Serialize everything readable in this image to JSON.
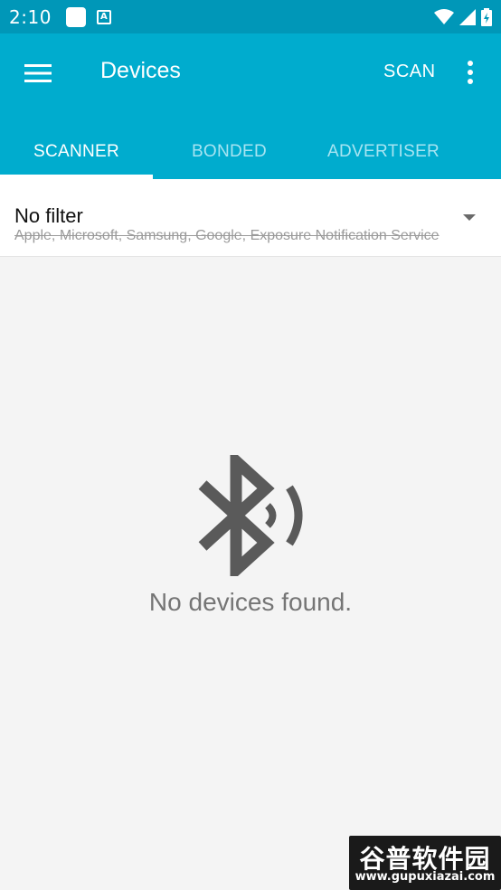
{
  "status_bar": {
    "time": "2:10",
    "notification_a": "A"
  },
  "app_bar": {
    "title": "Devices",
    "scan_label": "SCAN"
  },
  "tabs": [
    {
      "label": "SCANNER",
      "active": true
    },
    {
      "label": "BONDED",
      "active": false
    },
    {
      "label": "ADVERTISER",
      "active": false
    }
  ],
  "filter": {
    "title": "No filter",
    "subtitle": "Apple, Microsoft, Samsung, Google, Exposure Notification Service"
  },
  "empty_state": {
    "message": "No devices found.",
    "icon": "bluetooth-searching-icon"
  },
  "watermark": {
    "main": "谷普软件园",
    "url": "www.gupuxiazai.com"
  },
  "colors": {
    "status_bar": "#0097b8",
    "app_bar": "#00acce",
    "tab_inactive": "#a7e4f2",
    "background": "#f4f4f4",
    "icon_gray": "#5a5a5a"
  }
}
